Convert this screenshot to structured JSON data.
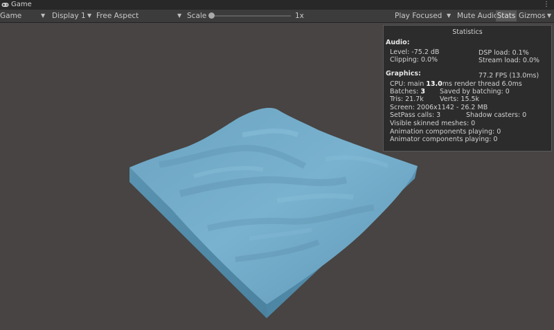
{
  "window": {
    "tab_label": "Game",
    "tab_icon": "gamepad-icon",
    "menu_icon": "kebab-menu-icon"
  },
  "toolbar": {
    "mode": "Game",
    "display": "Display 1",
    "aspect": "Free Aspect",
    "scale_label": "Scale",
    "scale_value": "1x",
    "play_mode": "Play Focused",
    "mute_audio": "Mute Audio",
    "stats": "Stats",
    "gizmos": "Gizmos"
  },
  "stats": {
    "title": "Statistics",
    "audio": {
      "heading": "Audio:",
      "level": "Level: -75.2 dB",
      "clipping": "Clipping: 0.0%",
      "dsp_load": "DSP load: 0.1%",
      "stream_load": "Stream load: 0.0%"
    },
    "graphics": {
      "heading": "Graphics:",
      "fps": "77.2 FPS (13.0ms)",
      "cpu_prefix": "CPU: main ",
      "cpu_main": "13.0",
      "cpu_suffix": "ms  render thread 6.0ms",
      "batches_prefix": "Batches: ",
      "batches": "3",
      "saved_by_batching": "Saved by batching: 0",
      "tris": "Tris: 21.7k",
      "verts": "Verts: 15.5k",
      "screen": "Screen: 2006x1142 - 26.2 MB",
      "setpass": "SetPass calls: 3",
      "shadow_casters": "Shadow casters: 0",
      "skinned_meshes": "Visible skinned meshes: 0",
      "animation_components": "Animation components playing: 0",
      "animator_components": "Animator components playing: 0"
    }
  },
  "colors": {
    "background": "#474443",
    "water_top": "#6ea8c6",
    "water_side": "#4d87a6",
    "panel": "#2a2a2a"
  }
}
